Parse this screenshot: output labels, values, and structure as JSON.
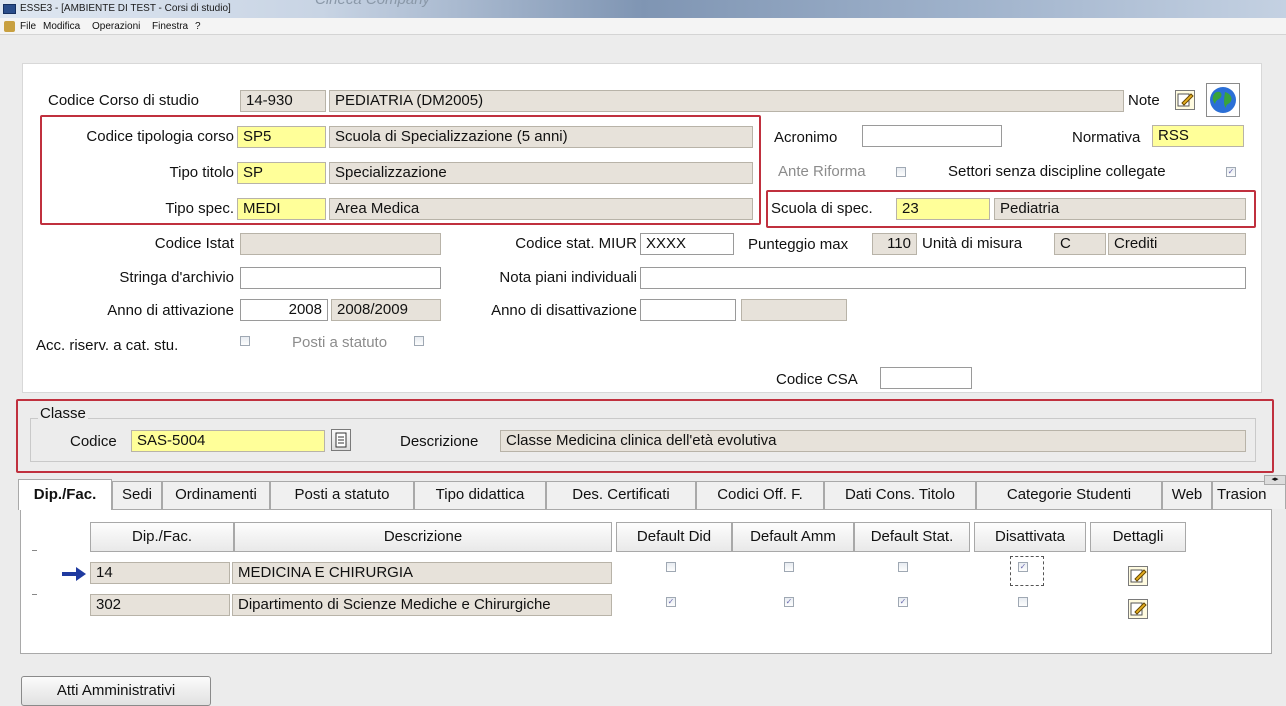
{
  "window": {
    "title": "ESSE3 - [AMBIENTE DI TEST - Corsi di studio]",
    "logo_text": "Cineca Company"
  },
  "menu": [
    "File",
    "Modifica",
    "Operazioni",
    "Finestra",
    "?"
  ],
  "course": {
    "label_codice": "Codice Corso di studio",
    "codice": "14-930",
    "descrizione": "PEDIATRIA (DM2005)",
    "label_note": "Note"
  },
  "tipologia": {
    "label": "Codice tipologia corso",
    "codice": "SP5",
    "descrizione": "Scuola di Specializzazione (5 anni)"
  },
  "tipo_titolo": {
    "label": "Tipo titolo",
    "codice": "SP",
    "descrizione": "Specializzazione"
  },
  "tipo_spec": {
    "label": "Tipo spec.",
    "codice": "MEDI",
    "descrizione": "Area Medica"
  },
  "acronimo": {
    "label": "Acronimo",
    "value": ""
  },
  "normativa": {
    "label": "Normativa",
    "value": "RSS"
  },
  "ante_riforma": {
    "label": "Ante Riforma",
    "checked": false
  },
  "settori": {
    "label": "Settori senza discipline collegate",
    "checked": true
  },
  "scuola_spec": {
    "label": "Scuola di spec.",
    "codice": "23",
    "descrizione": "Pediatria"
  },
  "istat": {
    "label": "Codice Istat",
    "value": ""
  },
  "stat_miur": {
    "label": "Codice stat. MIUR",
    "value": "XXXX"
  },
  "punteggio": {
    "label": "Punteggio max",
    "value": "110"
  },
  "unita": {
    "label": "Unità di misura",
    "codice": "C",
    "descrizione": "Crediti"
  },
  "stringa_archivio": {
    "label": "Stringa d'archivio",
    "value": ""
  },
  "nota_piani": {
    "label": "Nota piani individuali",
    "value": ""
  },
  "anno_attivazione": {
    "label": "Anno di attivazione",
    "anno": "2008",
    "aa": "2008/2009"
  },
  "anno_disattivazione": {
    "label": "Anno di disattivazione",
    "anno": "",
    "aa": ""
  },
  "acc_riserv": {
    "label": "Acc. riserv. a cat. stu.",
    "checked": false
  },
  "posti_statuto": {
    "label": "Posti a statuto",
    "checked": false
  },
  "codice_csa": {
    "label": "Codice CSA",
    "value": ""
  },
  "classe": {
    "group_label": "Classe",
    "label_codice": "Codice",
    "codice": "SAS-5004",
    "label_descrizione": "Descrizione",
    "descrizione": "Classe Medicina clinica dell'età evolutiva"
  },
  "tabs": [
    "Dip./Fac.",
    "Sedi",
    "Ordinamenti",
    "Posti a statuto",
    "Tipo didattica",
    "Des. Certificati",
    "Codici Off. F.",
    "Dati Cons. Titolo",
    "Categorie Studenti",
    "Web",
    "Trasion"
  ],
  "grid": {
    "headers": [
      "Dip./Fac.",
      "Descrizione",
      "Default Did",
      "Default Amm",
      "Default Stat.",
      "Disattivata",
      "Dettagli"
    ],
    "rows": [
      {
        "dip": "14",
        "descrizione": "MEDICINA E CHIRURGIA",
        "def_did": false,
        "def_amm": false,
        "def_stat": false,
        "disattivata": true
      },
      {
        "dip": "302",
        "descrizione": "Dipartimento di Scienze Mediche e  Chirurgiche",
        "def_did": true,
        "def_amm": true,
        "def_stat": true,
        "disattivata": false
      }
    ]
  },
  "atti_button": "Atti Amministrativi",
  "colors": {
    "highlight_yellow": "#ffff99",
    "readonly_field": "#e7e2da",
    "annotation_red": "#c0303e"
  }
}
